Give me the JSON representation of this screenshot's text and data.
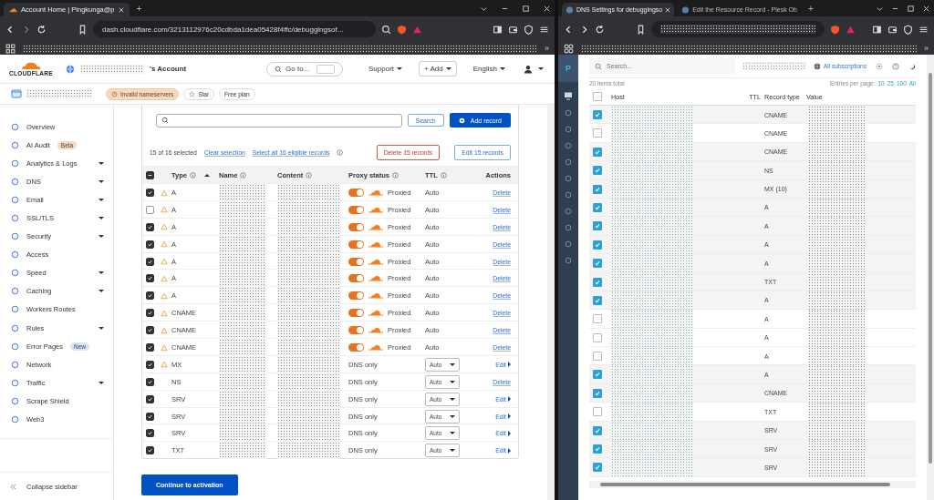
{
  "left_window": {
    "tabs": [
      {
        "title": "Account Home | Pingkunga@p",
        "selected": true
      }
    ],
    "new_tab": "+",
    "address": "dash.cloudflare.com/3213112976c20cdbda1dea05428f4ffc/debuggingsof...",
    "bookmarks_more": "»",
    "header": {
      "logo": "CLOUDFLARE",
      "account_suffix": "'s Account",
      "goto_placeholder": "Go to...",
      "support": "Support",
      "add": "+ Add",
      "language": "English"
    },
    "zone": {
      "status": "Invalid nameservers",
      "star": "Star",
      "plan": "Free plan"
    },
    "sidebar": {
      "items": [
        {
          "label": "Overview",
          "expandable": false
        },
        {
          "label": "AI Audit",
          "expandable": false,
          "badge": {
            "text": "Beta",
            "color": "#f8d9c0"
          }
        },
        {
          "label": "Analytics & Logs",
          "expandable": true
        },
        {
          "label": "DNS",
          "expandable": true
        },
        {
          "label": "Email",
          "expandable": true
        },
        {
          "label": "SSL/TLS",
          "expandable": true
        },
        {
          "label": "Security",
          "expandable": true
        },
        {
          "label": "Access",
          "expandable": false
        },
        {
          "label": "Speed",
          "expandable": true
        },
        {
          "label": "Caching",
          "expandable": true
        },
        {
          "label": "Workers Routes",
          "expandable": false
        },
        {
          "label": "Rules",
          "expandable": true
        },
        {
          "label": "Error Pages",
          "expandable": false,
          "badge": {
            "text": "New",
            "color": "#d5e4fb"
          }
        },
        {
          "label": "Network",
          "expandable": false
        },
        {
          "label": "Traffic",
          "expandable": true
        },
        {
          "label": "Scrape Shield",
          "expandable": false
        },
        {
          "label": "Web3",
          "expandable": false
        }
      ],
      "collapse": "Collapse sidebar"
    },
    "dns": {
      "search_button": "Search",
      "add_button": "Add record",
      "selection": "15 of 16 selected",
      "clear": "Clear selection",
      "select_all": "Select all 16 eligible records",
      "delete_button": "Delete 15 records",
      "edit_button": "Edit 15 records",
      "indeterminate": true,
      "columns": [
        "Type",
        "Name",
        "Content",
        "Proxy status",
        "TTL",
        "Actions"
      ],
      "rows": [
        {
          "checked": true,
          "warning": true,
          "type": "A",
          "proxied": true,
          "proxy": "Proxied",
          "ttl": "Auto",
          "action": "Delete",
          "editable": false
        },
        {
          "checked": false,
          "warning": true,
          "type": "A",
          "proxied": true,
          "proxy": "Proxied",
          "ttl": "Auto",
          "action": "Delete",
          "editable": false
        },
        {
          "checked": true,
          "warning": true,
          "type": "A",
          "proxied": true,
          "proxy": "Proxied",
          "ttl": "Auto",
          "action": "Delete",
          "editable": false
        },
        {
          "checked": true,
          "warning": true,
          "type": "A",
          "proxied": true,
          "proxy": "Proxied",
          "ttl": "Auto",
          "action": "Delete",
          "editable": false
        },
        {
          "checked": true,
          "warning": true,
          "type": "A",
          "proxied": true,
          "proxy": "Proxied",
          "ttl": "Auto",
          "action": "Delete",
          "editable": false
        },
        {
          "checked": true,
          "warning": true,
          "type": "A",
          "proxied": true,
          "proxy": "Proxied",
          "ttl": "Auto",
          "action": "Delete",
          "editable": false
        },
        {
          "checked": true,
          "warning": true,
          "type": "A",
          "proxied": true,
          "proxy": "Proxied",
          "ttl": "Auto",
          "action": "Delete",
          "editable": false
        },
        {
          "checked": true,
          "warning": true,
          "type": "CNAME",
          "proxied": true,
          "proxy": "Proxied",
          "ttl": "Auto",
          "action": "Delete",
          "editable": false
        },
        {
          "checked": true,
          "warning": true,
          "type": "CNAME",
          "proxied": true,
          "proxy": "Proxied",
          "ttl": "Auto",
          "action": "Delete",
          "editable": false
        },
        {
          "checked": true,
          "warning": true,
          "type": "CNAME",
          "proxied": true,
          "proxy": "Proxied",
          "ttl": "Auto",
          "action": "Delete",
          "editable": false
        },
        {
          "checked": true,
          "warning": true,
          "type": "MX",
          "proxied": false,
          "proxy": "DNS only",
          "ttl": "Auto",
          "action": "Edit",
          "editable": true
        },
        {
          "checked": true,
          "warning": false,
          "type": "NS",
          "proxied": false,
          "proxy": "DNS only",
          "ttl": "Auto",
          "action": "Delete",
          "editable": false
        },
        {
          "checked": true,
          "warning": false,
          "type": "SRV",
          "proxied": false,
          "proxy": "DNS only",
          "ttl": "Auto",
          "action": "Edit",
          "editable": true
        },
        {
          "checked": true,
          "warning": false,
          "type": "SRV",
          "proxied": false,
          "proxy": "DNS only",
          "ttl": "Auto",
          "action": "Edit",
          "editable": true
        },
        {
          "checked": true,
          "warning": false,
          "type": "SRV",
          "proxied": false,
          "proxy": "DNS only",
          "ttl": "Auto",
          "action": "Edit",
          "editable": true
        },
        {
          "checked": true,
          "warning": false,
          "type": "TXT",
          "proxied": false,
          "proxy": "DNS only",
          "ttl": "Auto",
          "action": "Edit",
          "editable": true
        }
      ]
    },
    "continue_button": "Continue to activation"
  },
  "right_window": {
    "tabs": [
      {
        "title": "DNS Settings for debuggingso",
        "selected": true
      },
      {
        "title": "Edit the Resource Record - Plesk Ob",
        "selected": false
      }
    ],
    "new_tab": "+",
    "bookmarks_more": "»",
    "logo": "P",
    "search_placeholder": "Search...",
    "subscriptions": "All subscriptions",
    "total": "20 items total",
    "per_page_label": "Entries per page:",
    "per_page_options": [
      "10",
      "25",
      "100",
      "All"
    ],
    "all_selected": false,
    "columns": [
      "Host",
      "TTL",
      "Record type",
      "Value"
    ],
    "rows": [
      {
        "checked": true,
        "type": "CNAME"
      },
      {
        "checked": false,
        "type": "CNAME"
      },
      {
        "checked": true,
        "type": "CNAME"
      },
      {
        "checked": true,
        "type": "NS"
      },
      {
        "checked": true,
        "type": "MX (10)"
      },
      {
        "checked": true,
        "type": "A"
      },
      {
        "checked": true,
        "type": "A"
      },
      {
        "checked": true,
        "type": "A"
      },
      {
        "checked": true,
        "type": "A"
      },
      {
        "checked": true,
        "type": "TXT"
      },
      {
        "checked": true,
        "type": "A"
      },
      {
        "checked": false,
        "type": "A"
      },
      {
        "checked": false,
        "type": "A"
      },
      {
        "checked": false,
        "type": "A"
      },
      {
        "checked": true,
        "type": "A"
      },
      {
        "checked": true,
        "type": "CNAME"
      },
      {
        "checked": false,
        "type": "TXT"
      },
      {
        "checked": true,
        "type": "SRV"
      },
      {
        "checked": true,
        "type": "SRV"
      },
      {
        "checked": true,
        "type": "SRV"
      }
    ]
  }
}
